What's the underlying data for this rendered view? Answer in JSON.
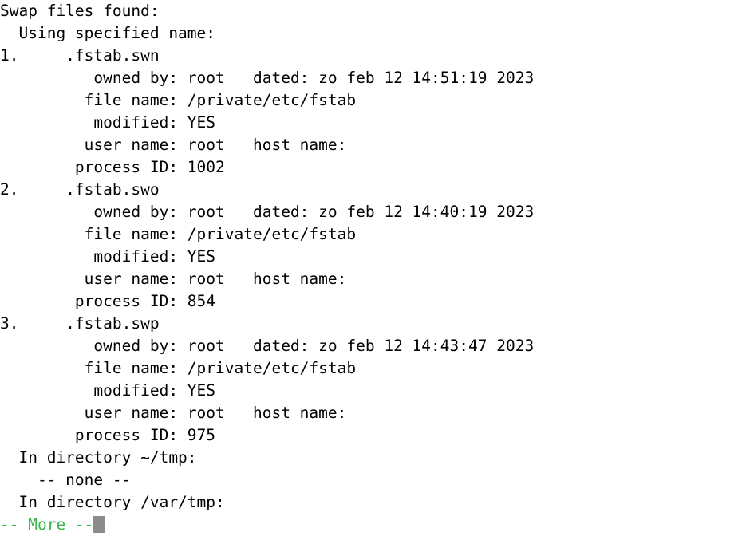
{
  "terminal": {
    "colors": {
      "background": "#ffffff",
      "foreground": "#000000",
      "prompt_green": "#3cb44a",
      "cursor_gray": "#8c8c8c"
    },
    "header": "Swap files found:",
    "subheader": "  Using specified name:",
    "labels": {
      "owned_by": "owned by:",
      "dated": "dated:",
      "file_name": "file name:",
      "modified": "modified:",
      "user_name": "user name:",
      "host_name": "host name:",
      "process_id": "process ID:"
    },
    "entries": [
      {
        "index": "1.",
        "swap_name": ".fstab.swn",
        "owned_by": "root",
        "dated": "zo feb 12 14:51:19 2023",
        "file_name": "/private/etc/fstab",
        "modified": "YES",
        "user_name": "root",
        "host_name": "",
        "process_id": "1002"
      },
      {
        "index": "2.",
        "swap_name": ".fstab.swo",
        "owned_by": "root",
        "dated": "zo feb 12 14:40:19 2023",
        "file_name": "/private/etc/fstab",
        "modified": "YES",
        "user_name": "root",
        "host_name": "",
        "process_id": "854"
      },
      {
        "index": "3.",
        "swap_name": ".fstab.swp",
        "owned_by": "root",
        "dated": "zo feb 12 14:43:47 2023",
        "file_name": "/private/etc/fstab",
        "modified": "YES",
        "user_name": "root",
        "host_name": "",
        "process_id": "975"
      }
    ],
    "directories": [
      {
        "heading": "  In directory ~/tmp:",
        "contents": "    -- none --"
      },
      {
        "heading": "  In directory /var/tmp:",
        "contents": null
      }
    ],
    "more_prompt": "-- More --"
  },
  "rendered_lines": [
    "Swap files found:",
    "  Using specified name:",
    "1.     .fstab.swn",
    "          owned by: root   dated: zo feb 12 14:51:19 2023",
    "         file name: /private/etc/fstab",
    "          modified: YES",
    "         user name: root   host name:",
    "        process ID: 1002",
    "2.     .fstab.swo",
    "          owned by: root   dated: zo feb 12 14:40:19 2023",
    "         file name: /private/etc/fstab",
    "          modified: YES",
    "         user name: root   host name:",
    "        process ID: 854",
    "3.     .fstab.swp",
    "          owned by: root   dated: zo feb 12 14:43:47 2023",
    "         file name: /private/etc/fstab",
    "          modified: YES",
    "         user name: root   host name:",
    "        process ID: 975",
    "  In directory ~/tmp:",
    "    -- none --",
    "  In directory /var/tmp:"
  ]
}
